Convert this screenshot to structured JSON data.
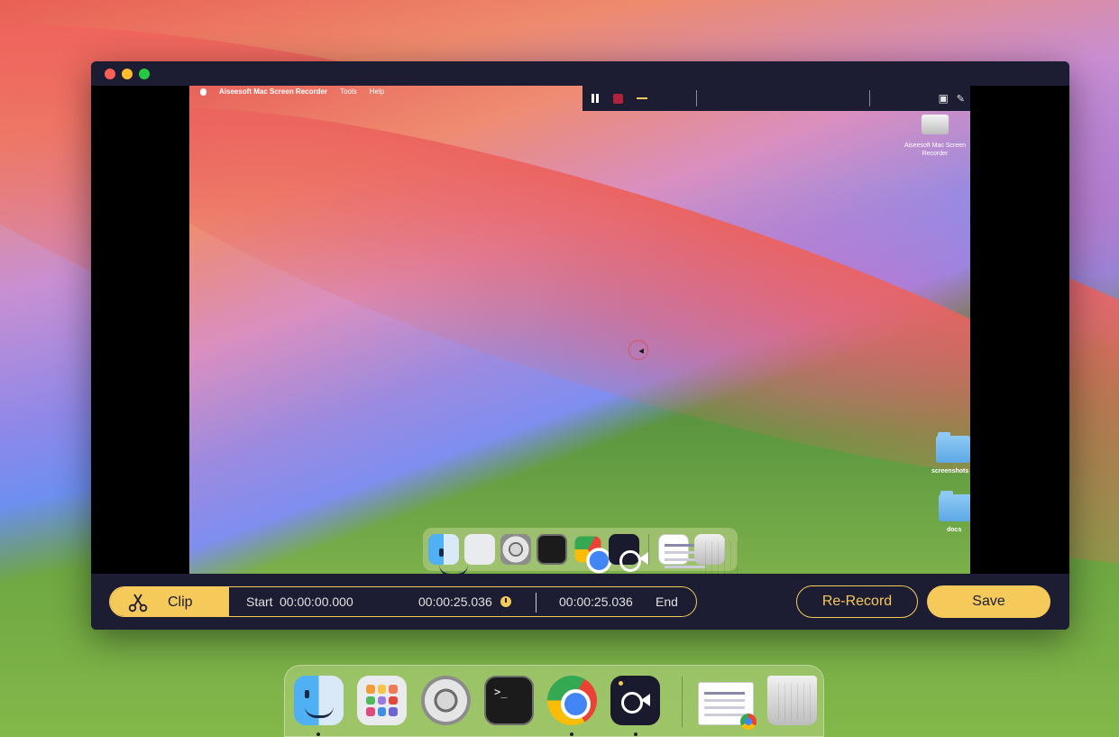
{
  "app": {
    "name": "Aiseesoft Mac Screen Recorder",
    "menus": [
      "Tools",
      "Help"
    ]
  },
  "recording_toolbar": {
    "pause_icon": "pause-icon",
    "stop_icon": "stop-icon",
    "minimize_icon": "minimize-icon",
    "camera_icon": "camera-icon",
    "edit_icon": "edit-icon"
  },
  "preview": {
    "drive_label": "Aiseesoft Mac Screen Recorder",
    "folders": [
      "screenshots",
      "docs"
    ]
  },
  "clip": {
    "clip_label": "Clip",
    "start_label": "Start",
    "start_time": "00:00:00.000",
    "current_time": "00:00:25.036",
    "end_time": "00:00:25.036",
    "end_label": "End"
  },
  "actions": {
    "rerecord_label": "Re-Record",
    "save_label": "Save"
  },
  "dock": {
    "items": [
      "finder-icon",
      "launchpad-icon",
      "system-settings-icon",
      "terminal-icon",
      "chrome-icon",
      "screen-recorder-icon",
      "document-icon",
      "trash-icon"
    ],
    "terminal_glyph": ">_"
  },
  "colors": {
    "accent": "#f5c95a",
    "bar_bg": "#1c1c33",
    "stop_red": "#b0233c"
  }
}
